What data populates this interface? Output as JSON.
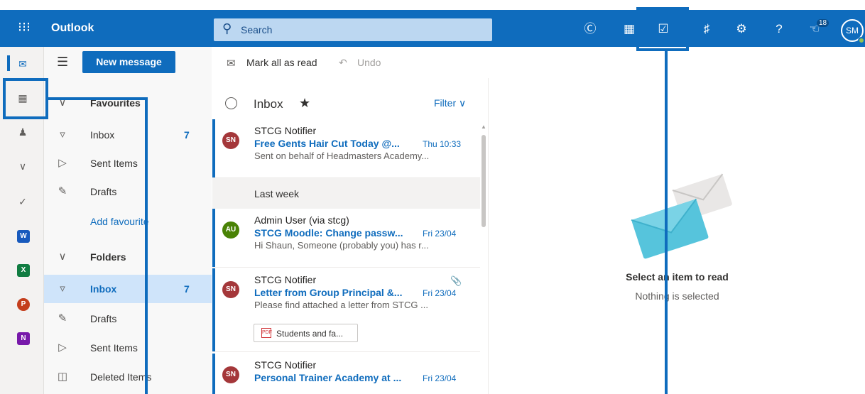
{
  "app": {
    "waffle_glyph": "⁝⁝⁝",
    "name": "Outlook"
  },
  "search": {
    "placeholder": "Search"
  },
  "topbar_icons": [
    "skype-icon",
    "teams-icon",
    "my-day-icon",
    "bell-icon",
    "gear-icon",
    "help-icon",
    "feedback-icon"
  ],
  "feedback_count": "18",
  "user": {
    "initials": "SM"
  },
  "toolbar": {
    "new_message": "New message",
    "mark_all_read": "Mark all as read",
    "undo": "Undo"
  },
  "folders": {
    "favourites_header": "Favourites",
    "favourites": [
      {
        "label": "Inbox",
        "count": "7"
      },
      {
        "label": "Sent Items",
        "count": ""
      },
      {
        "label": "Drafts",
        "count": ""
      },
      {
        "label": "Add favourite",
        "count": ""
      }
    ],
    "folders_header": "Folders",
    "folders": [
      {
        "label": "Inbox",
        "count": "7"
      },
      {
        "label": "Drafts",
        "count": ""
      },
      {
        "label": "Sent Items",
        "count": ""
      },
      {
        "label": "Deleted Items",
        "count": ""
      }
    ]
  },
  "list": {
    "title": "Inbox",
    "filter": "Filter",
    "section_last_week": "Last week",
    "messages": [
      {
        "initials": "SN",
        "avatar_color": "#a4373a",
        "sender": "STCG Notifier",
        "subject": "Free Gents Hair Cut Today @...",
        "time": "Thu 10:33",
        "preview": "Sent on behalf of Headmasters Academy..."
      },
      {
        "initials": "AU",
        "avatar_color": "#498205",
        "sender": "Admin User (via stcg)",
        "subject": "STCG Moodle: Change passw...",
        "time": "Fri 23/04",
        "preview": "Hi Shaun, Someone (probably you) has r..."
      },
      {
        "initials": "SN",
        "avatar_color": "#a4373a",
        "sender": "STCG Notifier",
        "subject": "Letter from Group Principal &...",
        "time": "Fri 23/04",
        "preview": "Please find attached a letter from STCG ...",
        "attachment": "Students and fa..."
      },
      {
        "initials": "SN",
        "avatar_color": "#a4373a",
        "sender": "STCG Notifier",
        "subject": "Personal Trainer Academy at ...",
        "time": "Fri 23/04",
        "preview": ""
      }
    ]
  },
  "reading": {
    "title": "Select an item to read",
    "subtitle": "Nothing is selected"
  },
  "colors": {
    "brand": "#0f6cbd",
    "selected": "#cfe4fa"
  }
}
